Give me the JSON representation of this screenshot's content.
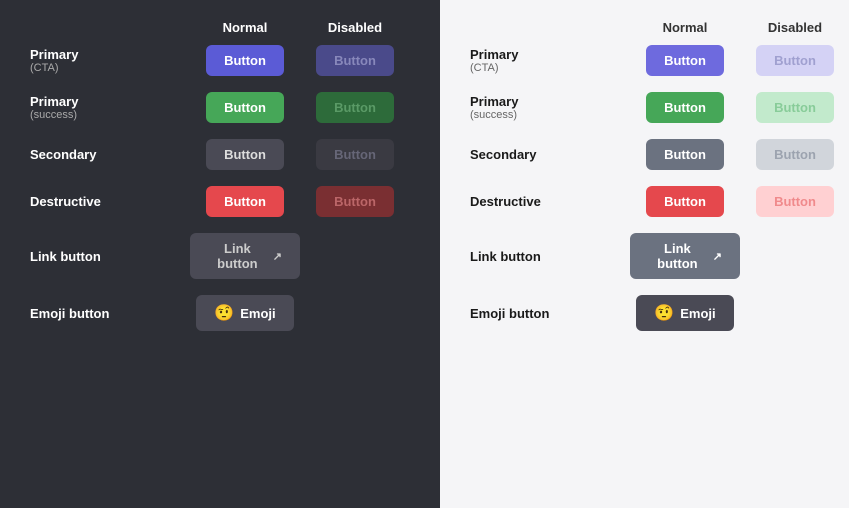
{
  "panels": [
    {
      "id": "dark",
      "theme": "dark",
      "columns": {
        "normal": "Normal",
        "disabled": "Disabled"
      },
      "rows": [
        {
          "label": "Primary",
          "sublabel": "(CTA)",
          "normalClass": "btn-primary-cta",
          "disabledClass": "btn-primary-cta-disabled",
          "normalText": "Button",
          "disabledText": "Button"
        },
        {
          "label": "Primary",
          "sublabel": "(success)",
          "normalClass": "btn-primary-success",
          "disabledClass": "btn-primary-success-disabled",
          "normalText": "Button",
          "disabledText": "Button"
        },
        {
          "label": "Secondary",
          "sublabel": "",
          "normalClass": "btn-secondary",
          "disabledClass": "btn-secondary-disabled",
          "normalText": "Button",
          "disabledText": "Button"
        },
        {
          "label": "Destructive",
          "sublabel": "",
          "normalClass": "btn-destructive",
          "disabledClass": "btn-destructive-disabled",
          "normalText": "Button",
          "disabledText": "Button"
        },
        {
          "label": "Link button",
          "sublabel": "",
          "type": "link",
          "normalClass": "btn-link",
          "normalText": "Link button"
        },
        {
          "label": "Emoji button",
          "sublabel": "",
          "type": "emoji",
          "normalClass": "btn-emoji",
          "normalText": "Emoji",
          "emoji": "🤨"
        }
      ]
    },
    {
      "id": "light",
      "theme": "light",
      "columns": {
        "normal": "Normal",
        "disabled": "Disabled"
      },
      "rows": [
        {
          "label": "Primary",
          "sublabel": "(CTA)",
          "normalClass": "btn-primary-cta",
          "disabledClass": "btn-primary-cta-disabled",
          "normalText": "Button",
          "disabledText": "Button"
        },
        {
          "label": "Primary",
          "sublabel": "(success)",
          "normalClass": "btn-primary-success",
          "disabledClass": "btn-primary-success-disabled",
          "normalText": "Button",
          "disabledText": "Button"
        },
        {
          "label": "Secondary",
          "sublabel": "",
          "normalClass": "btn-secondary",
          "disabledClass": "btn-secondary-disabled",
          "normalText": "Button",
          "disabledText": "Button"
        },
        {
          "label": "Destructive",
          "sublabel": "",
          "normalClass": "btn-destructive",
          "disabledClass": "btn-destructive-disabled",
          "normalText": "Button",
          "disabledText": "Button"
        },
        {
          "label": "Link button",
          "sublabel": "",
          "type": "link",
          "normalClass": "btn-link",
          "normalText": "Link button"
        },
        {
          "label": "Emoji button",
          "sublabel": "",
          "type": "emoji",
          "normalClass": "btn-emoji",
          "normalText": "Emoji",
          "emoji": "🤨"
        }
      ]
    }
  ]
}
